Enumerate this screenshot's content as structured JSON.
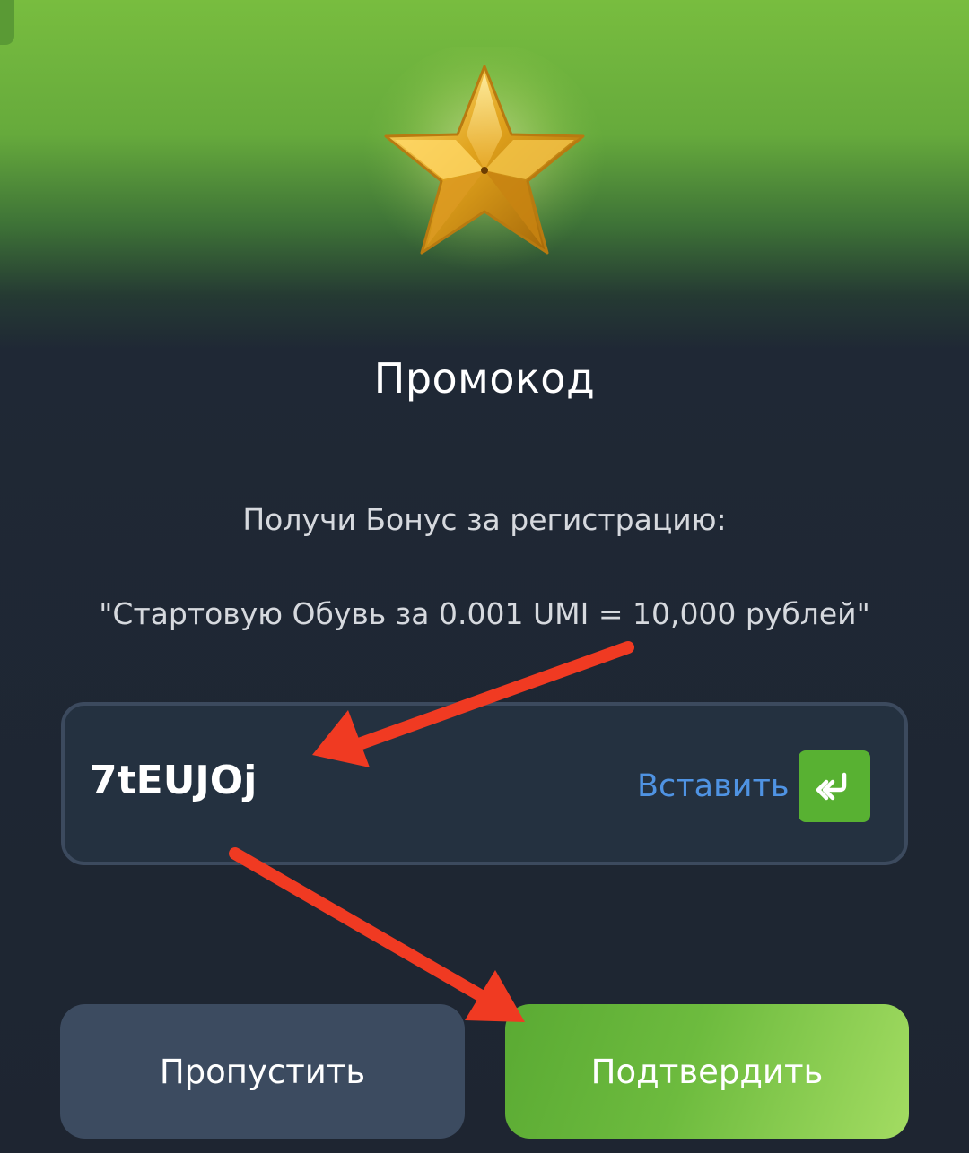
{
  "dialog": {
    "title": "Промокод",
    "subtitle": "Получи Бонус за регистрацию:",
    "offer": "\"Стартовую Обувь за 0.001 UMI = 10,000 рублей\""
  },
  "promo_input": {
    "value": "7tEUJOj",
    "paste_label": "Вставить",
    "paste_icon": "double-chevron-enter-icon"
  },
  "actions": {
    "skip_label": "Пропустить",
    "confirm_label": "Подтвердить"
  },
  "colors": {
    "accent_green": "#58b132",
    "link_blue": "#4f93e3",
    "annotation_red": "#f03a22",
    "background": "#1e2531"
  },
  "decorations": {
    "hero_icon": "gold-star-icon",
    "annotation_arrows": [
      "red-arrow-to-code",
      "red-arrow-to-confirm"
    ]
  }
}
